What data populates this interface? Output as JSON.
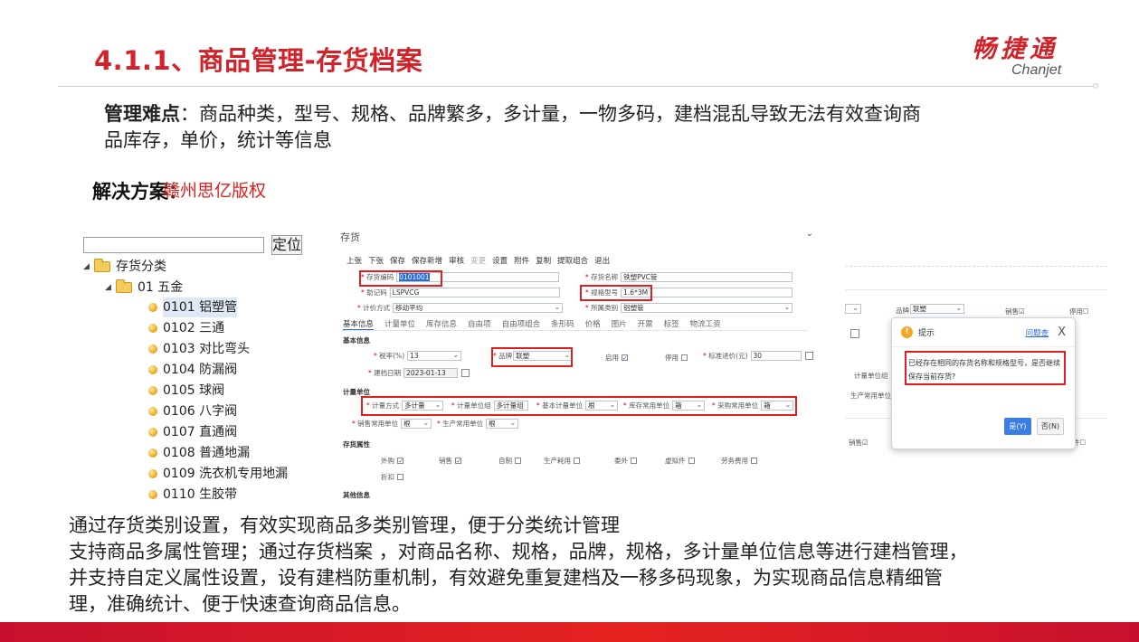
{
  "header": {
    "title": "4.1.1、商品管理-存货档案",
    "logo_cn": "畅捷通",
    "logo_en": "Chanjet"
  },
  "difficulty": {
    "label": "管理难点",
    "text_line1": "：商品种类，型号、规格、品牌繁多，多计量，一物多码，建档混乱导致无法有效查询商",
    "text_line2": "品库存，单价，统计等信息"
  },
  "solution": {
    "label": "解决方案：",
    "watermark": "赣州思亿版权"
  },
  "tree": {
    "search_button": "定位",
    "root": "存货分类",
    "group": "01 五金",
    "items": [
      "0101 铝塑管",
      "0102 三通",
      "0103 对比弯头",
      "0104 防漏阀",
      "0105 球阀",
      "0106 八字阀",
      "0107 直通阀",
      "0108 普通地漏",
      "0109 洗衣机专用地漏",
      "0110 生胶带"
    ]
  },
  "form": {
    "window_title": "存货",
    "collapse": "⌄",
    "toolbar": [
      "上张",
      "下张",
      "保存",
      "保存新增",
      "审核",
      "变更",
      "设置",
      "附件",
      "复制",
      "提取组合",
      "退出"
    ],
    "fields": {
      "code_label": "存货编码",
      "code_value": "0101001",
      "name_label": "存货名称",
      "name_value": "铁塑PVC管",
      "mnemonic_label": "助记码",
      "mnemonic_value": "LSPVCG",
      "spec_label": "规格型号",
      "spec_value": "1.6*3M",
      "valuation_label": "计价方式",
      "valuation_value": "移动平均",
      "category_label": "所属类别",
      "category_value": "铝塑管"
    },
    "tabs": [
      "基本信息",
      "计量单位",
      "库存信息",
      "自由项",
      "自由项组合",
      "条形码",
      "价格",
      "图片",
      "开票",
      "标签",
      "物流工资"
    ],
    "section_basic": "基本信息",
    "tax_label": "税率(%)",
    "tax_value": "13",
    "brand_label": "品牌",
    "brand_value": "联塑",
    "enabled_label": "启用",
    "disabled_label": "停用",
    "cost_label": "标准进价(元)",
    "cost_value": "30",
    "date_label": "建档日期",
    "date_value": "2023-01-13",
    "section_unit": "计量单位",
    "unit_mode_label": "计量方式",
    "unit_mode_value": "多计量",
    "unit_group_label": "计量单位组",
    "unit_group_value": "多计量组",
    "base_unit_label": "基本计量单位",
    "base_unit_value": "根",
    "stock_unit_label": "库存常用单位",
    "stock_unit_value": "箱",
    "purchase_unit_label": "采购常用单位",
    "purchase_unit_value": "箱",
    "sale_unit_label": "销售常用单位",
    "sale_unit_value": "根",
    "prod_unit_label": "生产常用单位",
    "prod_unit_value": "根",
    "section_storage": "存货属性",
    "attrs": [
      "外购",
      "销售",
      "自制",
      "生产耗用",
      "委外",
      "虚拟件",
      "劳务费用",
      "折扣"
    ],
    "attrs_checked": [
      true,
      true,
      false,
      false,
      false,
      false,
      false,
      false
    ],
    "section_other": "其他信息"
  },
  "rpanel": {
    "brand_label": "品牌",
    "brand_value": "联塑",
    "sale_label": "销售",
    "disable_label": "停用",
    "unit_group_label": "计量单位组",
    "prod_unit_label": "生产常用单位",
    "sale2_label": "销售",
    "last_label": "件"
  },
  "dialog": {
    "icon": "!",
    "title": "提示",
    "link": "问题查",
    "close": "X",
    "message": "已经存在相同的存货名称和规格型号，是否继续保存当前存货?",
    "yes": "是(Y)",
    "no": "否(N)"
  },
  "body": {
    "line1": "通过存货类别设置，有效实现商品多类别管理，便于分类统计管理",
    "line2": "支持商品多属性管理；通过存货档案 ，对商品名称、规格，品牌，规格，多计量单位信息等进行建档管理，",
    "line3": "并支持自定义属性设置，设有建档防重机制，有效避免重复建档及一移多码现象，为实现商品信息精细管",
    "line4": "理，准确统计、便于快速查询商品信息。"
  }
}
